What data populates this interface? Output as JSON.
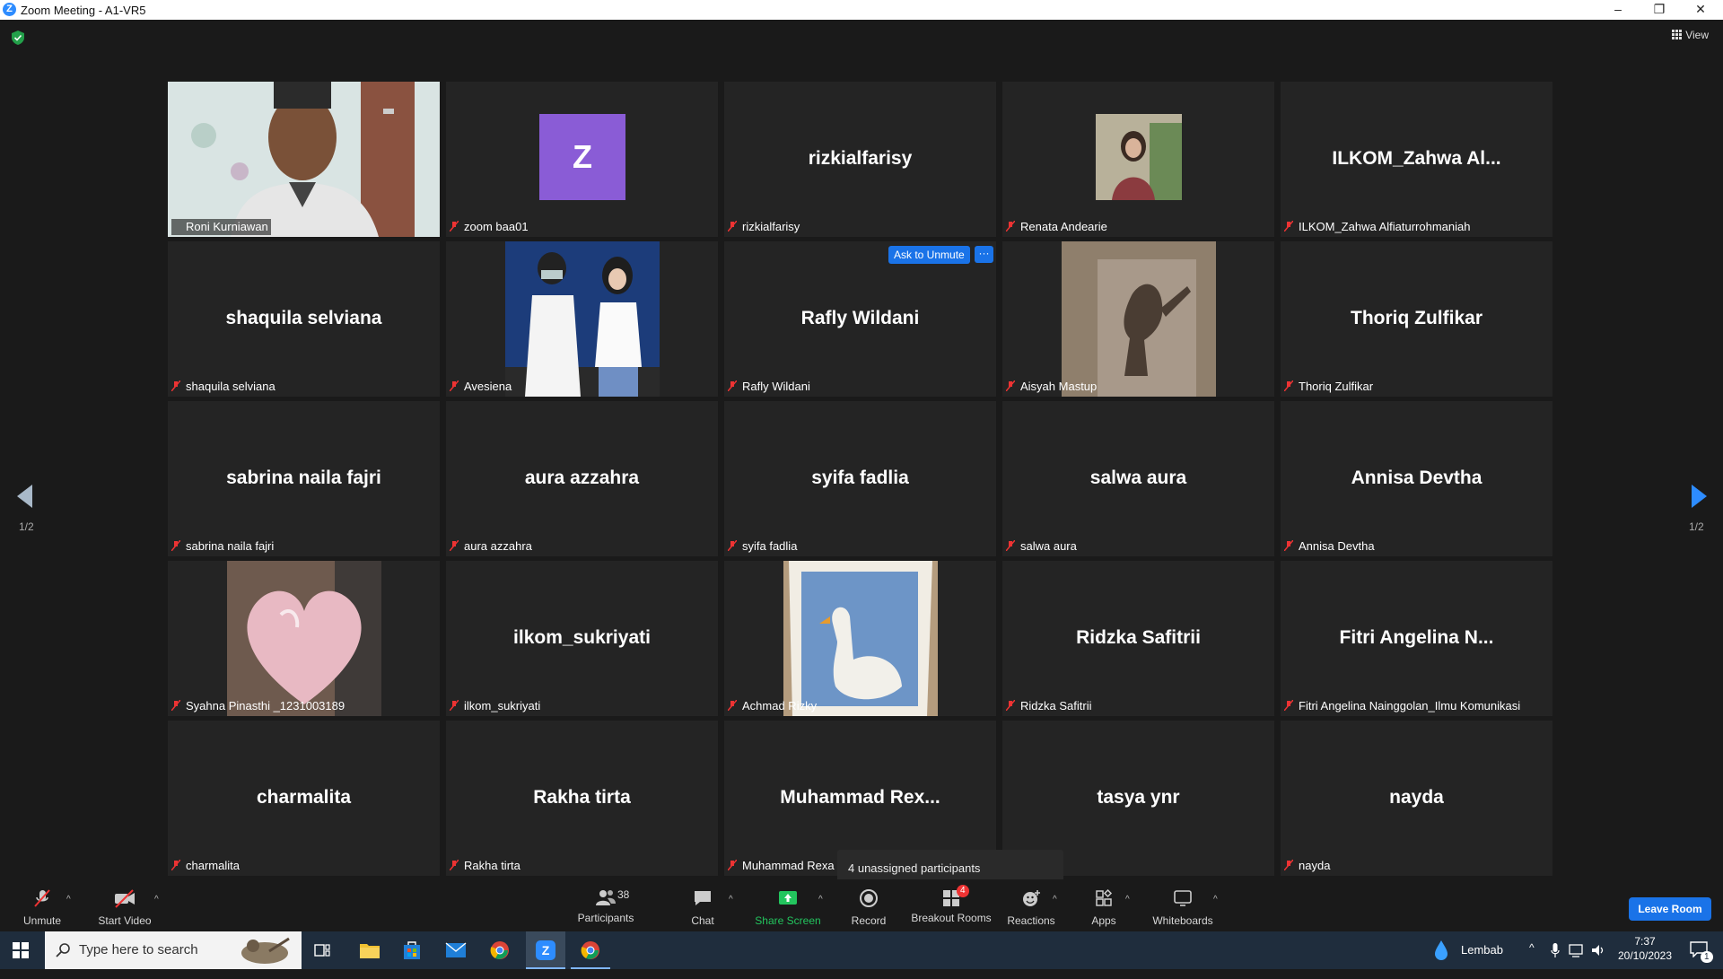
{
  "window": {
    "title": "Zoom Meeting - A1-VR5",
    "logo_letter": "Z",
    "controls": {
      "minimize": "–",
      "restore": "❐",
      "close": "✕"
    }
  },
  "meeting": {
    "view_label": "View",
    "page_indicator_left": "1/2",
    "page_indicator_right": "1/2",
    "unassigned_popup": "4 unassigned participants",
    "accent_active": "#f1f27a",
    "accent_blue": "#1a73e8"
  },
  "tiles": [
    {
      "label": "Roni Kurniawan",
      "display": "",
      "active": true,
      "video": "camera"
    },
    {
      "label": "zoom baa01",
      "display": "",
      "avatar": "Z"
    },
    {
      "label": "rizkialfarisy",
      "display": "rizkialfarisy"
    },
    {
      "label": "Renata Andearie",
      "display": "",
      "video": "photo"
    },
    {
      "label": "ILKOM_Zahwa Alfiaturrohmaniah",
      "display": "ILKOM_Zahwa  Al..."
    },
    {
      "label": "shaquila selviana",
      "display": "shaquila selviana"
    },
    {
      "label": "Avesiena",
      "display": "",
      "video": "photo"
    },
    {
      "label": "Rafly Wildani",
      "display": "Rafly Wildani",
      "ask_to_unmute": "Ask to Unmute",
      "more": "···"
    },
    {
      "label": "Aisyah Mastup",
      "display": "",
      "video": "shadow"
    },
    {
      "label": "Thoriq Zulfikar",
      "display": "Thoriq Zulfikar"
    },
    {
      "label": "sabrina naila fajri",
      "display": "sabrina naila fajri"
    },
    {
      "label": "aura azzahra",
      "display": "aura azzahra"
    },
    {
      "label": "syifa fadlia",
      "display": "syifa fadlia"
    },
    {
      "label": "salwa aura",
      "display": "salwa aura"
    },
    {
      "label": "Annisa Devtha",
      "display": "Annisa Devtha"
    },
    {
      "label": "Syahna Pinasthi _1231003189",
      "display": "",
      "video": "heart"
    },
    {
      "label": "ilkom_sukriyati",
      "display": "ilkom_sukriyati"
    },
    {
      "label": "Achmad Rizky",
      "display": "",
      "video": "drawing"
    },
    {
      "label": "Ridzka Safitrii",
      "display": "Ridzka Safitrii"
    },
    {
      "label": "Fitri Angelina Nainggolan_Ilmu Komunikasi",
      "display": "Fitri  Angelina  N..."
    },
    {
      "label": "charmalita",
      "display": "charmalita"
    },
    {
      "label": "Rakha tirta",
      "display": "Rakha tirta"
    },
    {
      "label": "Muhammad Rexa",
      "display": "Muhammad  Rex..."
    },
    {
      "label": "r",
      "display": "tasya ynr"
    },
    {
      "label": "nayda",
      "display": "nayda"
    }
  ],
  "toolbar": {
    "unmute": "Unmute",
    "start_video": "Start Video",
    "participants": "Participants",
    "participants_count": "38",
    "chat": "Chat",
    "share_screen": "Share Screen",
    "record": "Record",
    "breakout_rooms": "Breakout Rooms",
    "breakout_badge": "4",
    "reactions": "Reactions",
    "apps": "Apps",
    "whiteboards": "Whiteboards",
    "leave_room": "Leave Room"
  },
  "taskbar": {
    "search_placeholder": "Type here to search",
    "weather": "Lembab",
    "time": "7:37",
    "date": "20/10/2023",
    "notification_count": "1"
  }
}
